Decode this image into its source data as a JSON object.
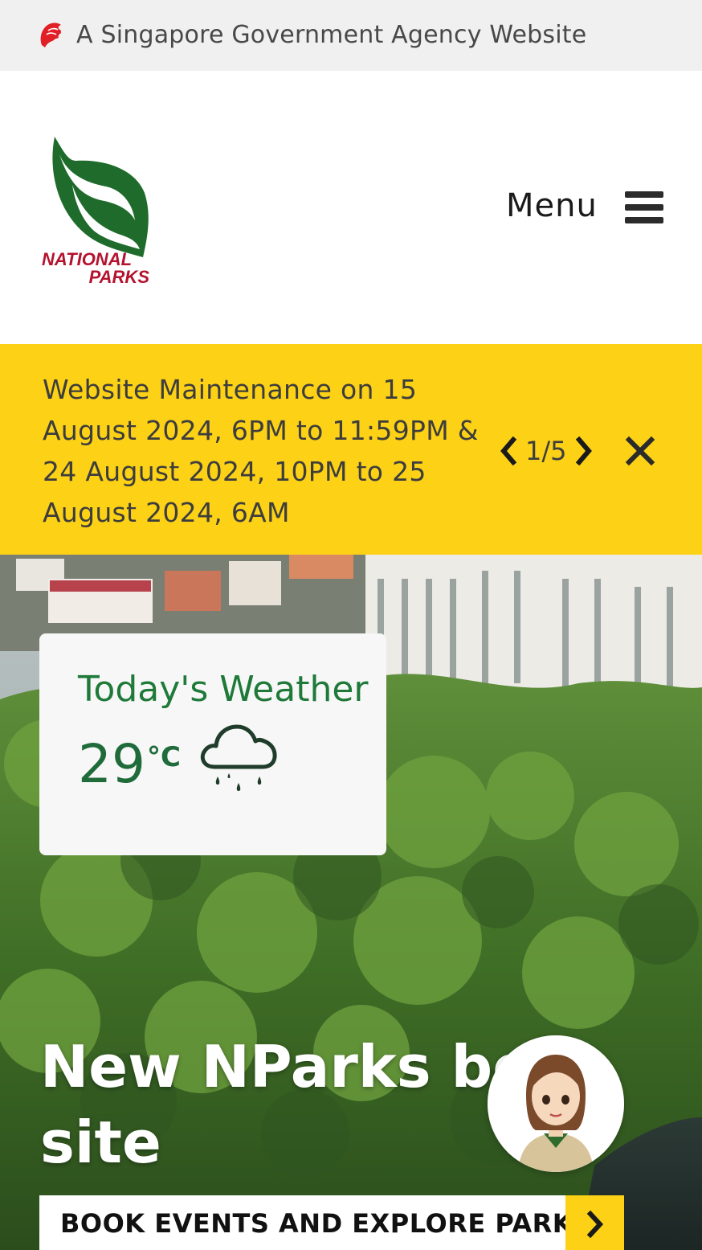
{
  "masthead": {
    "text": "A Singapore Government Agency Website",
    "lion_color": "#e01f26"
  },
  "header": {
    "logo_line1": "NATIONAL",
    "logo_line2": "PARKS",
    "menu_label": "Menu",
    "logo_green": "#1f6b2c",
    "logo_red": "#b5122e"
  },
  "alert": {
    "message": "Website Maintenance on 15 August 2024, 6PM to 11:59PM & 24 August 2024, 10PM to 25 August 2024, 6AM",
    "counter": "1/5",
    "background": "#fcd116"
  },
  "weather": {
    "title": "Today's Weather",
    "temperature": "29",
    "unit": "°C",
    "condition_icon": "rain-cloud-icon"
  },
  "hero": {
    "title": "New NParks beta site",
    "cta_label": "BOOK EVENTS AND EXPLORE PARKS"
  },
  "chatbot": {
    "icon": "ranger-avatar-icon"
  }
}
